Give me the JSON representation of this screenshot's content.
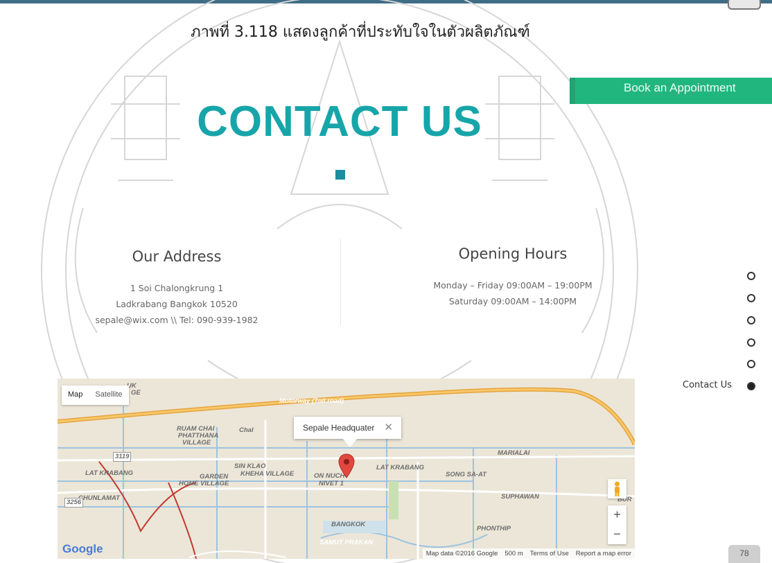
{
  "caption": "ภาพที่ 3.118 แสดงลูกค้าที่ประทับใจในตัวผลิตภัณฑ์",
  "book_button": "Book an Appointment",
  "title": "CONTACT US",
  "address": {
    "heading": "Our Address",
    "line1": "1 Soi Chalongkrung 1",
    "line2": "Ladkrabang  Bangkok 10520",
    "line3": "sepale@wix.com \\\\ Tel: 090-939-1982"
  },
  "hours": {
    "heading": "Opening Hours",
    "line1": "Monday – Friday  09:00AM – 19:00PM",
    "line2": "Saturday    09:00AM – 14:00PM"
  },
  "side_nav": {
    "active_label": "Contact Us"
  },
  "map": {
    "type_map": "Map",
    "type_satellite": "Satellite",
    "popup_title": "Sepale Headquater",
    "popup_close": "✕",
    "zoom_in": "+",
    "zoom_out": "−",
    "logo": "Google",
    "footer": {
      "data": "Map data ©2016 Google",
      "scale": "500 m",
      "terms": "Terms of Use",
      "report": "Report a map error"
    },
    "labels": {
      "motorway": "Motorway (Toll road)",
      "lat_krabang_w": "LAT KRABANG",
      "lat_krabang_e": "LAT KRABANG",
      "ruam_chai": "RUAM CHAI",
      "phatthana": "PHATTHANA",
      "village": "VILLAGE",
      "sin_klao": "SIN KLAO",
      "khe_ha": "KHEHA VILLAGE",
      "garden": "GARDEN",
      "home_village": "HOME VILLAGE",
      "on_nuch": "ON NUCH",
      "nivet": "NIVET 1",
      "chunlamat": "CHUNLAMAT",
      "song_sa_at": "SONG SA-AT",
      "marialai": "MARIALAI",
      "suphawan": "SUPHAWAN",
      "phonthip": "PHONTHIP",
      "bangkok": "BANGKOK",
      "samut_prakan": "SAMUT PRAKAN",
      "route_3119": "3119",
      "route_3256": "3256",
      "chal": "Chal",
      "bur": "BUR",
      "uk": "UK",
      "ge": "GE"
    }
  },
  "page_number": "78",
  "colors": {
    "title": "#17a5a9",
    "book_button": "#22b67f",
    "top_bar": "#3f6d86"
  }
}
